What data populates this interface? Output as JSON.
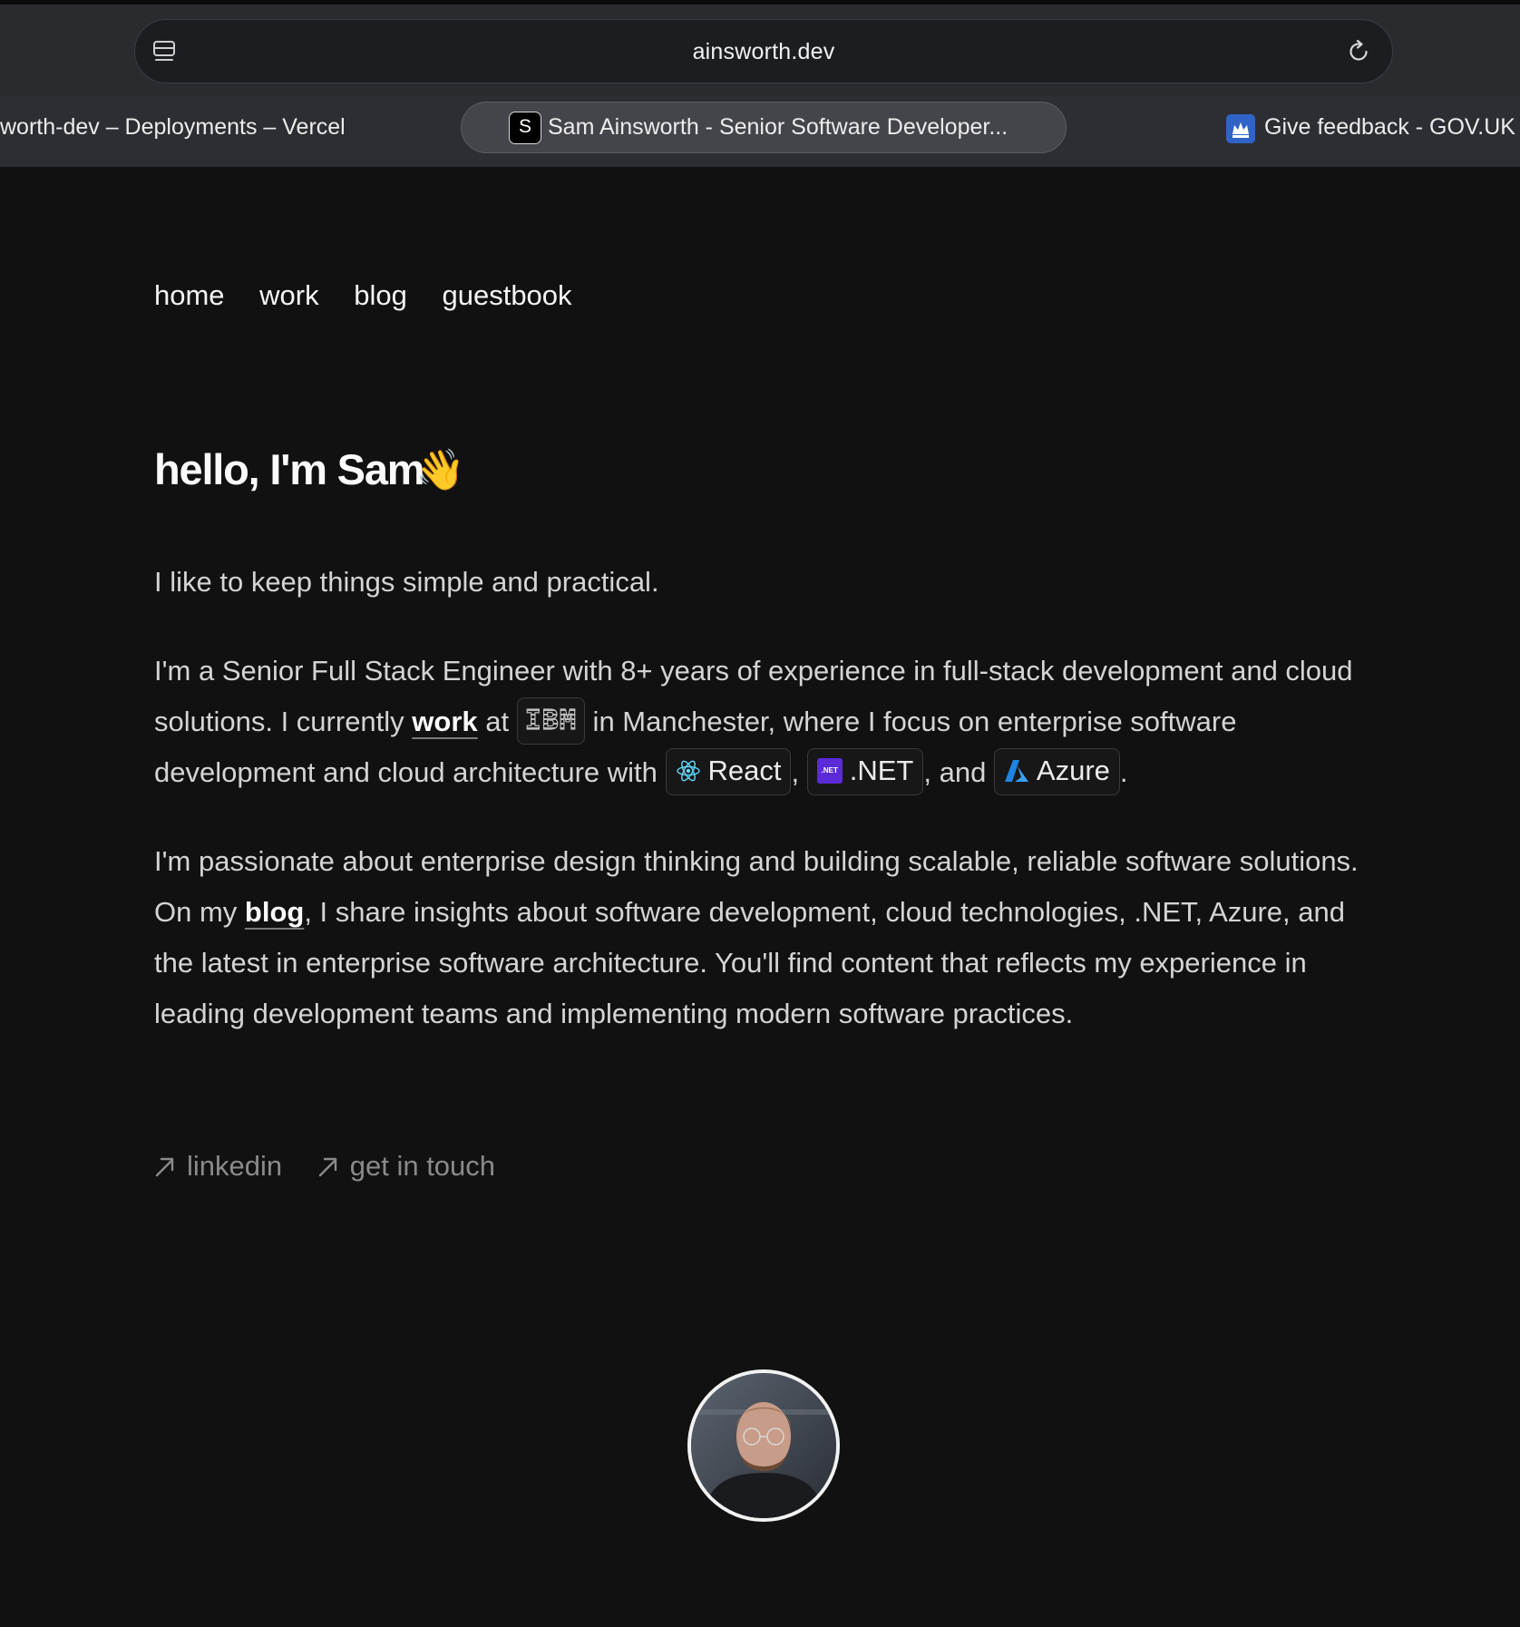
{
  "browser": {
    "url": "ainsworth.dev",
    "tabs": [
      {
        "title": "worth-dev – Deployments – Vercel"
      },
      {
        "title": "Sam Ainsworth - Senior Software Developer...",
        "favicon_letter": "S"
      },
      {
        "title": "Give feedback - GOV.UK"
      }
    ]
  },
  "nav": {
    "items": [
      "home",
      "work",
      "blog",
      "guestbook"
    ]
  },
  "hero": {
    "greeting": "hello, I'm Sam",
    "emoji": "👋"
  },
  "intro": {
    "p1": "I like to keep things simple and practical.",
    "p2_a": "I'm a Senior Full Stack Engineer with 8+ years of experience in full-stack development and cloud solutions. I currently ",
    "p2_work_link": "work",
    "p2_b": " at ",
    "ibm_label": "IBM",
    "p2_c": " in Manchester, where I focus on enterprise software development and cloud architecture with ",
    "react_label": "React",
    "comma": ",",
    "net_label": ".NET",
    "net_badge": ".NET",
    "and": ", and ",
    "azure_label": "Azure",
    "period": ".",
    "p3_a": "I'm passionate about enterprise design thinking and building scalable, reliable software solutions. On my ",
    "p3_blog_link": "blog",
    "p3_b": ", I share insights about software development, cloud technologies, .NET, Azure, and the latest in enterprise software architecture. You'll find content that reflects my experience in leading development teams and implementing modern software practices."
  },
  "links": {
    "linkedin": "linkedin",
    "contact": "get in touch"
  },
  "icons": {
    "sidebar": "sidebar-icon",
    "reload": "reload-icon",
    "react": "react-icon",
    "azure": "azure-icon",
    "arrow": "arrow-up-right-icon"
  },
  "colors": {
    "background": "#111112",
    "chrome": "#2a2b2f",
    "text": "#d4d4d4",
    "muted": "#8a8a8c",
    "react": "#61dafb",
    "dotnet": "#5b2bd7",
    "azure": "#1f84e3"
  }
}
